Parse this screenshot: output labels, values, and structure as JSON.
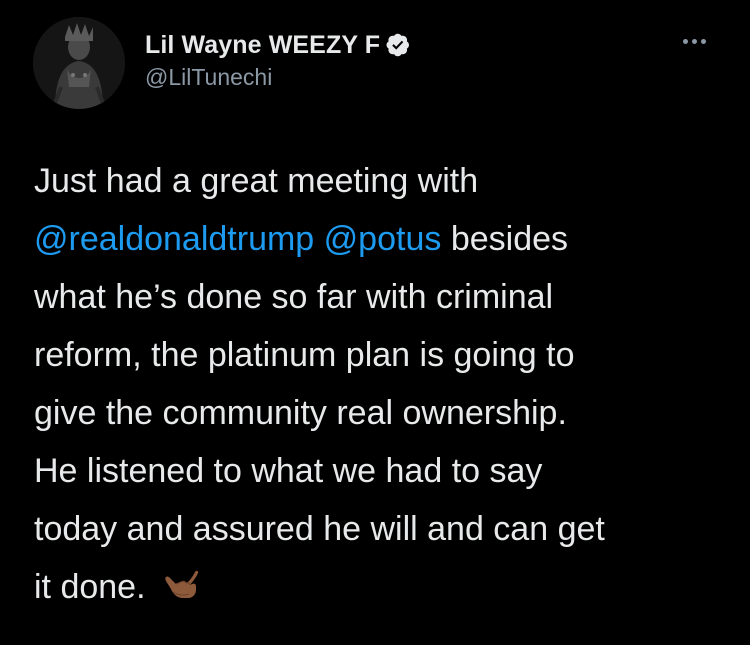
{
  "author": {
    "display_name": "Lil Wayne WEEZY F",
    "handle": "@LilTunechi",
    "verified": true,
    "avatar_icon": "profile-photo"
  },
  "more_menu": {
    "icon": "more-horizontal-icon"
  },
  "tweet": {
    "lines": [
      {
        "before": "Just had a great meeting with"
      },
      {
        "mention1": "@realdonaldtrump",
        "space": " ",
        "mention2": "@potus",
        "after": " besides"
      },
      {
        "text": "what he’s done so far with criminal"
      },
      {
        "text": "reform, the platinum plan is going to"
      },
      {
        "text": "give the community real ownership."
      },
      {
        "text": "He listened to what we had to say"
      },
      {
        "text": "today and assured he will and can get"
      },
      {
        "text": "it done. "
      }
    ],
    "emoji": "call-me-hand-medium-dark-skin-tone"
  },
  "colors": {
    "background": "#000000",
    "text": "#e7e9ea",
    "secondary_text": "#8b98a5",
    "mention": "#1d9bf0",
    "verified_badge": "#e7e9ea"
  }
}
